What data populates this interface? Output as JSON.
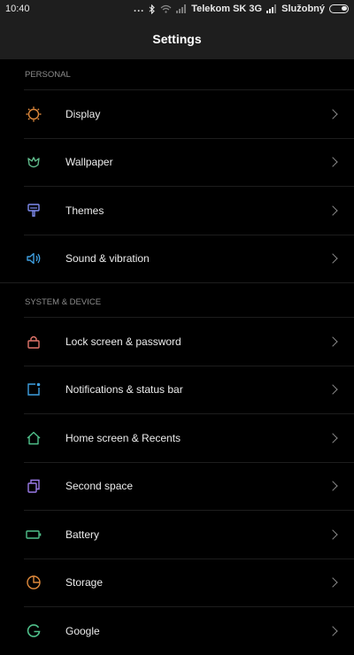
{
  "status_bar": {
    "time": "10:40",
    "dots": "...",
    "carrier": "Telekom SK 3G",
    "profile": "Služobný"
  },
  "header": {
    "title": "Settings"
  },
  "sections": [
    {
      "title": "PERSONAL",
      "items": [
        {
          "label": "Display",
          "icon": "display-icon",
          "color": "#e08a3c"
        },
        {
          "label": "Wallpaper",
          "icon": "wallpaper-icon",
          "color": "#5fb98a"
        },
        {
          "label": "Themes",
          "icon": "themes-icon",
          "color": "#7f8cf0"
        },
        {
          "label": "Sound & vibration",
          "icon": "sound-icon",
          "color": "#3e9fe0"
        }
      ]
    },
    {
      "title": "SYSTEM & DEVICE",
      "items": [
        {
          "label": "Lock screen & password",
          "icon": "lock-icon",
          "color": "#e0746a"
        },
        {
          "label": "Notifications & status bar",
          "icon": "notifications-icon",
          "color": "#3e9fe0"
        },
        {
          "label": "Home screen & Recents",
          "icon": "home-icon",
          "color": "#4fbf8a"
        },
        {
          "label": "Second space",
          "icon": "second-space-icon",
          "color": "#9b7be8"
        },
        {
          "label": "Battery",
          "icon": "battery-icon",
          "color": "#4fbf8a"
        },
        {
          "label": "Storage",
          "icon": "storage-icon",
          "color": "#e08a3c"
        },
        {
          "label": "Google",
          "icon": "google-icon",
          "color": "#4fbf8a"
        }
      ]
    }
  ]
}
